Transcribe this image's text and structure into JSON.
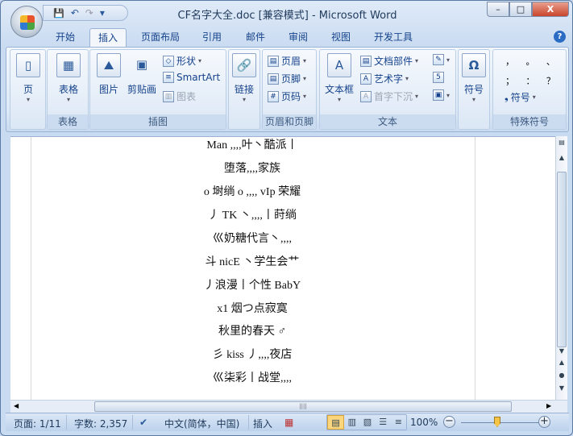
{
  "window": {
    "title": "CF名字大全.doc [兼容模式] - Microsoft Word",
    "min": "–",
    "max": "□",
    "close": "X"
  },
  "qat": {
    "save": "💾",
    "undo": "↶",
    "redo": "↷",
    "more": "▾"
  },
  "tabs": [
    "开始",
    "插入",
    "页面布局",
    "引用",
    "邮件",
    "审阅",
    "视图",
    "开发工具"
  ],
  "active_tab": "插入",
  "help": "?",
  "ribbon": {
    "groups": {
      "pages": "",
      "tables": "表格",
      "illustrations": "插图",
      "links": "",
      "header_footer": "页眉和页脚",
      "text": "文本",
      "special": "特殊符号"
    },
    "page": "页",
    "table": "表格",
    "picture": "图片",
    "clipart": "剪贴画",
    "shapes": "形状",
    "smartart": "SmartArt",
    "chart": "图表",
    "link": "链接",
    "header": "页眉",
    "footer": "页脚",
    "page_number": "页码",
    "textbox": "文本框",
    "quickparts": "文档部件",
    "wordart": "艺术字",
    "dropcap": "首字下沉",
    "symbol": "符号",
    "symbol_small": "符号",
    "omega": "Ω",
    "special_chars": [
      "，",
      "。",
      "、",
      "；",
      "：",
      "？"
    ]
  },
  "document": {
    "lines": [
      "Man ,,,,叶丶酷派丨",
      "堕落,,,,家族",
      "o 埘绱 o ,,,, vIp 荣耀",
      "丿 TK 丶,,,,丨莳绱",
      "巛奶糖代言丶,,,,",
      "斗 nicE 丶学生会艹",
      "丿浪漫丨个性 BabY",
      "x1 烟つ点寂寞",
      "秋里的春天 ♂",
      "彡 kiss 丿,,,,夜店",
      "巛柒彩丨战堂,,,,"
    ]
  },
  "status": {
    "page": "页面: 1/11",
    "words": "字数: 2,357",
    "language": "中文(简体，中国)",
    "mode": "插入",
    "zoom": "100%",
    "zoom_percent": 100
  }
}
